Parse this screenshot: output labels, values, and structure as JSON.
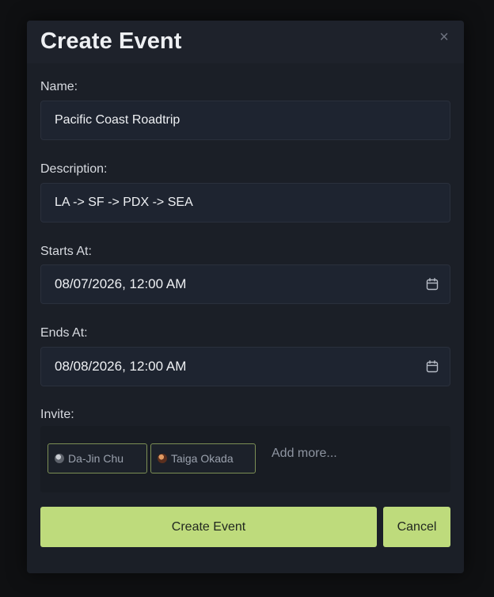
{
  "modal": {
    "title": "Create Event",
    "close_icon": "close-icon",
    "close_glyph": "×"
  },
  "fields": {
    "name": {
      "label": "Name:",
      "value": "Pacific Coast Roadtrip"
    },
    "description": {
      "label": "Description:",
      "value": "LA -> SF -> PDX -> SEA"
    },
    "starts_at": {
      "label": "Starts At:",
      "value": "08/07/2026, 12:00 AM",
      "icon": "calendar-icon"
    },
    "ends_at": {
      "label": "Ends At:",
      "value": "08/08/2026, 12:00 AM",
      "icon": "calendar-icon"
    }
  },
  "invite": {
    "label": "Invite:",
    "invitees": [
      {
        "name": "Da-Jin Chu",
        "avatar_color": "#8a8f99"
      },
      {
        "name": "Taiga Okada",
        "avatar_color": "#b0643c"
      }
    ],
    "add_more_placeholder": "Add more..."
  },
  "actions": {
    "create_label": "Create Event",
    "cancel_label": "Cancel"
  },
  "colors": {
    "accent": "#bedb7c",
    "modal_bg": "#1b1f27",
    "chip_border": "#7c8f55"
  }
}
